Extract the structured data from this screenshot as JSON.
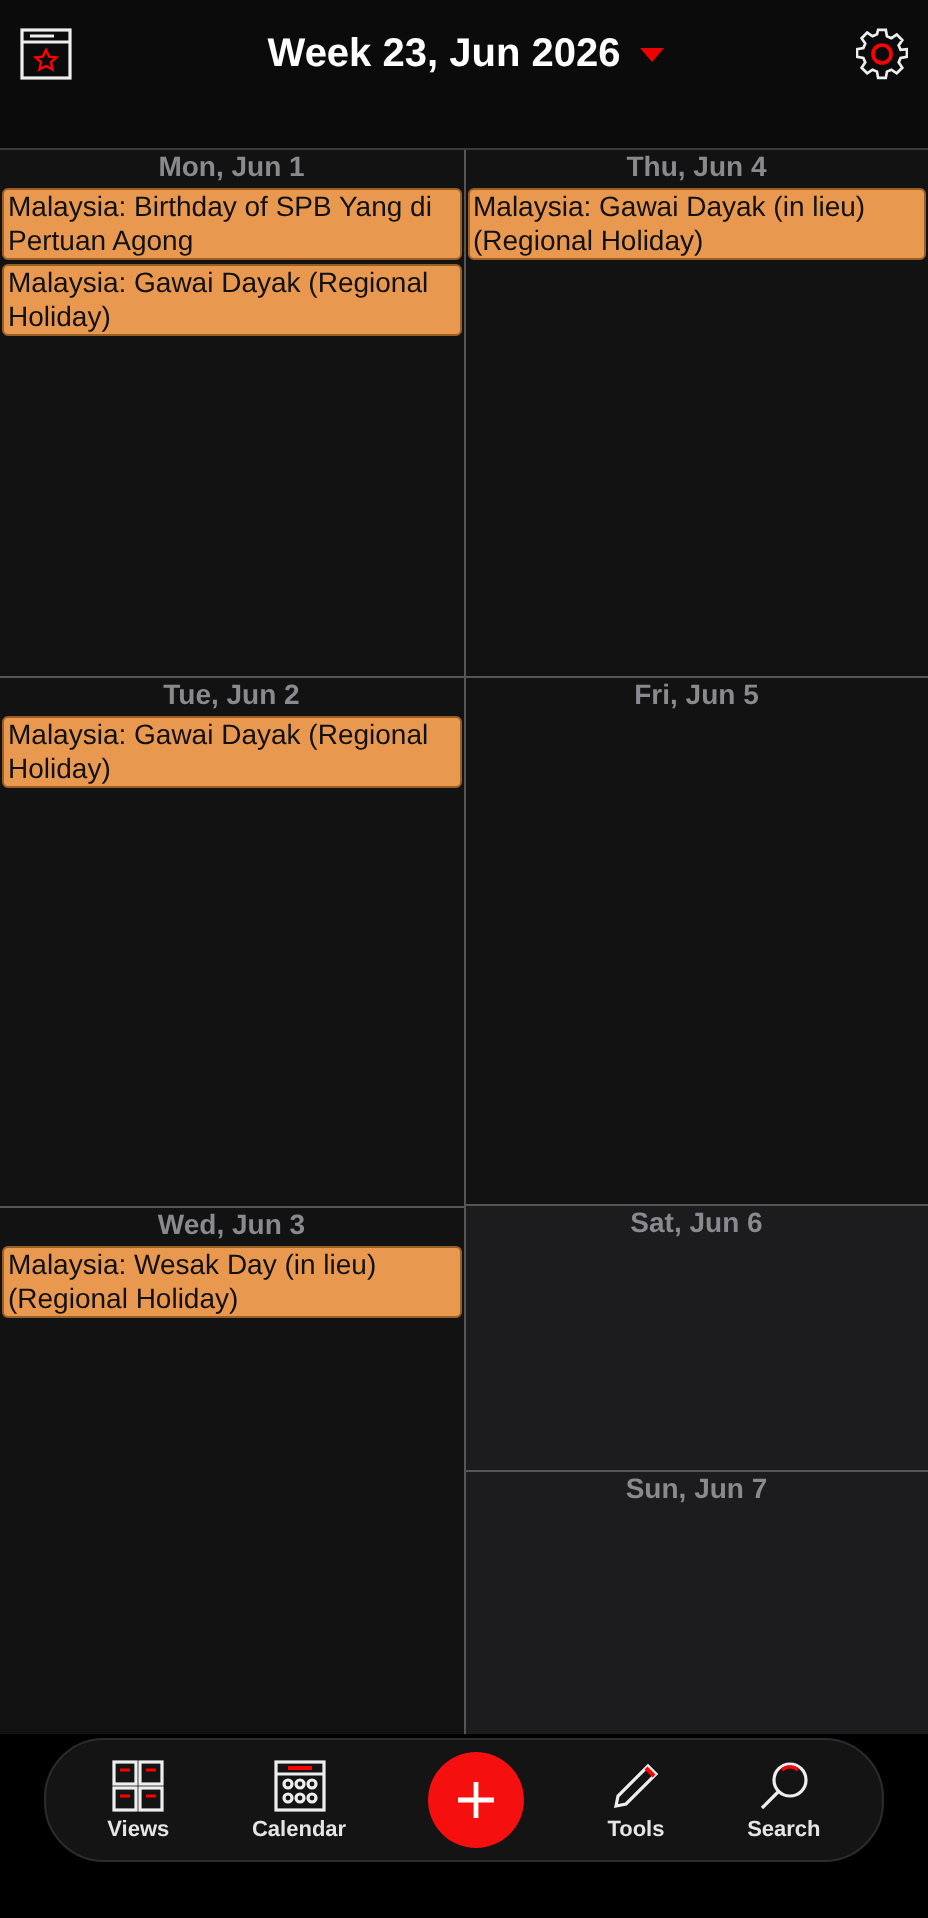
{
  "header": {
    "title": "Week 23, Jun 2026"
  },
  "columns": [
    {
      "days": [
        {
          "label": "Mon, Jun 1",
          "weekend": false,
          "events": [
            "Malaysia: Birthday of SPB Yang di Pertuan Agong",
            "Malaysia: Gawai Dayak (Regional Holiday)"
          ]
        },
        {
          "label": "Tue, Jun 2",
          "weekend": false,
          "events": [
            "Malaysia: Gawai Dayak (Regional Holiday)"
          ]
        },
        {
          "label": "Wed, Jun 3",
          "weekend": false,
          "events": [
            "Malaysia: Wesak Day (in lieu) (Regional Holiday)"
          ]
        }
      ]
    },
    {
      "days": [
        {
          "label": "Thu, Jun 4",
          "weekend": false,
          "events": [
            "Malaysia: Gawai Dayak (in lieu) (Regional Holiday)"
          ]
        },
        {
          "label": "Fri, Jun 5",
          "weekend": false
        },
        {
          "label": "Sat, Jun 6",
          "weekend": true
        },
        {
          "label": "Sun, Jun 7",
          "weekend": true
        }
      ]
    }
  ],
  "nav": [
    {
      "kind": "views",
      "label": "Views"
    },
    {
      "kind": "calendar",
      "label": "Calendar"
    },
    {
      "kind": "add"
    },
    {
      "kind": "tools",
      "label": "Tools"
    },
    {
      "kind": "search",
      "label": "Search"
    }
  ]
}
